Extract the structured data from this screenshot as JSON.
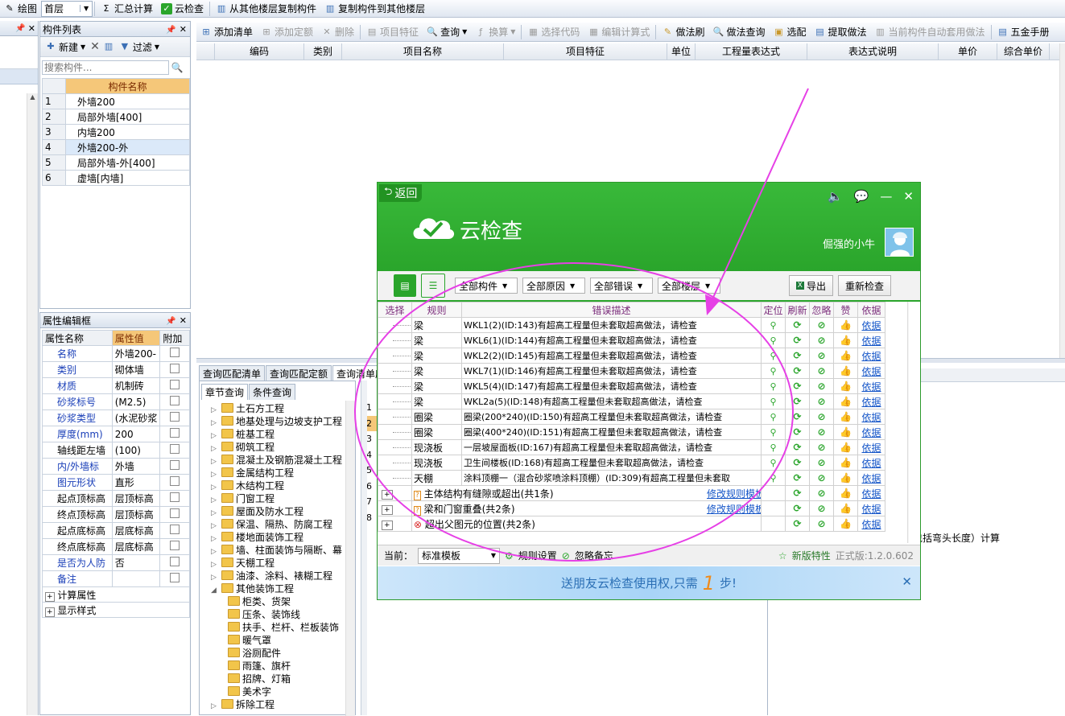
{
  "toolbar1": {
    "draw_label": "绘图",
    "floor_value": "首层",
    "sum_label": "汇总计算",
    "cloud_label": "云检查",
    "copy_from_label": "从其他楼层复制构件",
    "copy_to_label": "复制构件到其他楼层"
  },
  "component_list": {
    "title": "构件列表",
    "new_label": "新建",
    "filter_label": "过滤",
    "search_placeholder": "搜索构件...",
    "col_header": "构件名称",
    "rows": [
      {
        "no": "1",
        "name": "外墙200"
      },
      {
        "no": "2",
        "name": "局部外墙[400]"
      },
      {
        "no": "3",
        "name": "内墙200"
      },
      {
        "no": "4",
        "name": "外墙200-外"
      },
      {
        "no": "5",
        "name": "局部外墙-外[400]"
      },
      {
        "no": "6",
        "name": "虚墙[内墙]"
      }
    ]
  },
  "props": {
    "title": "属性编辑框",
    "col_name": "属性名称",
    "col_value": "属性值",
    "col_extra": "附加",
    "rows": [
      {
        "name": "名称",
        "value": "外墙200-",
        "blue": true
      },
      {
        "name": "类别",
        "value": "砌体墙",
        "blue": true
      },
      {
        "name": "材质",
        "value": "机制砖",
        "blue": true
      },
      {
        "name": "砂浆标号",
        "value": "(M2.5)",
        "blue": true
      },
      {
        "name": "砂浆类型",
        "value": "(水泥砂浆",
        "blue": true
      },
      {
        "name": "厚度(mm)",
        "value": "200",
        "blue": true
      },
      {
        "name": "轴线距左墙",
        "value": "(100)",
        "blue": false
      },
      {
        "name": "内/外墙标",
        "value": "外墙",
        "blue": true
      },
      {
        "name": "图元形状",
        "value": "直形",
        "blue": true
      },
      {
        "name": "起点顶标高",
        "value": "层顶标高",
        "blue": false
      },
      {
        "name": "终点顶标高",
        "value": "层顶标高",
        "blue": false
      },
      {
        "name": "起点底标高",
        "value": "层底标高",
        "blue": false
      },
      {
        "name": "终点底标高",
        "value": "层底标高",
        "blue": false
      },
      {
        "name": "是否为人防",
        "value": "否",
        "blue": true
      },
      {
        "name": "备注",
        "value": "",
        "blue": true
      }
    ],
    "group1": "计算属性",
    "group2": "显示样式"
  },
  "toolbar2": {
    "add_list": "添加清单",
    "add_quota": "添加定额",
    "delete": "删除",
    "feature": "项目特征",
    "query": "查询",
    "convert": "换算",
    "select_code": "选择代码",
    "edit_formula": "编辑计算式",
    "method_brush": "做法刷",
    "method_query": "做法查询",
    "pick": "选配",
    "extract": "提取做法",
    "auto_apply": "当前构件自动套用做法",
    "manual": "五金手册"
  },
  "main_headers": [
    "编码",
    "类别",
    "项目名称",
    "项目特征",
    "单位",
    "工程量表达式",
    "表达式说明",
    "单价",
    "综合单价"
  ],
  "query": {
    "tabs": [
      "查询匹配清单",
      "查询匹配定额",
      "查询清单库"
    ],
    "subtabs": [
      "章节查询",
      "条件查询"
    ],
    "tree": [
      {
        "label": "土石方工程",
        "level": 0,
        "open": false
      },
      {
        "label": "地基处理与边坡支护工程",
        "level": 0,
        "open": false
      },
      {
        "label": "桩基工程",
        "level": 0,
        "open": false
      },
      {
        "label": "砌筑工程",
        "level": 0,
        "open": false
      },
      {
        "label": "混凝土及钢筋混凝土工程",
        "level": 0,
        "open": false
      },
      {
        "label": "金属结构工程",
        "level": 0,
        "open": false
      },
      {
        "label": "木结构工程",
        "level": 0,
        "open": false
      },
      {
        "label": "门窗工程",
        "level": 0,
        "open": false
      },
      {
        "label": "屋面及防水工程",
        "level": 0,
        "open": false
      },
      {
        "label": "保温、隔热、防腐工程",
        "level": 0,
        "open": false
      },
      {
        "label": "楼地面装饰工程",
        "level": 0,
        "open": false
      },
      {
        "label": "墙、柱面装饰与隔断、幕",
        "level": 0,
        "open": false
      },
      {
        "label": "天棚工程",
        "level": 0,
        "open": false
      },
      {
        "label": "油漆、涂料、裱糊工程",
        "level": 0,
        "open": false
      },
      {
        "label": "其他装饰工程",
        "level": 0,
        "open": true
      },
      {
        "label": "柜类、货架",
        "level": 1
      },
      {
        "label": "压条、装饰线",
        "level": 1
      },
      {
        "label": "扶手、栏杆、栏板装饰",
        "level": 1
      },
      {
        "label": "暖气罩",
        "level": 1
      },
      {
        "label": "浴厕配件",
        "level": 1
      },
      {
        "label": "雨篷、旗杆",
        "level": 1
      },
      {
        "label": "招牌、灯箱",
        "level": 1
      },
      {
        "label": "美术字",
        "level": 1
      },
      {
        "label": "拆除工程",
        "level": 0,
        "open": false
      }
    ],
    "row_numbers": [
      "1",
      "2",
      "3",
      "4",
      "5",
      "6",
      "7",
      "8"
    ],
    "right_text": "包括弯头长度）计算"
  },
  "dialog": {
    "back_label": "返回",
    "title": "云检查",
    "username": "倔强的小牛",
    "filters": [
      "全部构件",
      "全部原因",
      "全部错误",
      "全部楼层"
    ],
    "export_label": "导出",
    "recheck_label": "重新检查",
    "headers": {
      "select": "选择",
      "rule": "规则",
      "desc": "错误描述",
      "locate": "定位",
      "refresh": "刷新",
      "ignore": "忽略",
      "like": "赞",
      "basis": "依据"
    },
    "rows": [
      {
        "rule": "梁",
        "desc": "WKL1(2)(ID:143)有超高工程量但未套取超高做法，请检查",
        "basis": "依据"
      },
      {
        "rule": "梁",
        "desc": "WKL6(1)(ID:144)有超高工程量但未套取超高做法，请检查",
        "basis": "依据"
      },
      {
        "rule": "梁",
        "desc": "WKL2(2)(ID:145)有超高工程量但未套取超高做法，请检查",
        "basis": "依据"
      },
      {
        "rule": "梁",
        "desc": "WKL7(1)(ID:146)有超高工程量但未套取超高做法，请检查",
        "basis": "依据"
      },
      {
        "rule": "梁",
        "desc": "WKL5(4)(ID:147)有超高工程量但未套取超高做法，请检查",
        "basis": "依据"
      },
      {
        "rule": "梁",
        "desc": "WKL2a(5)(ID:148)有超高工程量但未套取超高做法，请检查",
        "basis": "依据"
      },
      {
        "rule": "圈梁",
        "desc": "圈梁(200*240)(ID:150)有超高工程量但未套取超高做法，请检查",
        "basis": "依据"
      },
      {
        "rule": "圈梁",
        "desc": "圈梁(400*240)(ID:151)有超高工程量但未套取超高做法，请检查",
        "basis": "依据"
      },
      {
        "rule": "现浇板",
        "desc": "一层坡屋面板(ID:167)有超高工程量但未套取超高做法，请检查",
        "basis": "依据"
      },
      {
        "rule": "现浇板",
        "desc": "卫生间楼板(ID:168)有超高工程量但未套取超高做法，请检查",
        "basis": "依据"
      },
      {
        "rule": "天棚",
        "desc": "涂料顶棚一（混合砂浆喷涂料顶棚）(ID:309)有超高工程量但未套取",
        "basis": "依据"
      }
    ],
    "groups": [
      {
        "label": "主体结构有缝隙或超出(共1条)",
        "link": "修改规则模板",
        "basis": "依据",
        "kind": "warn"
      },
      {
        "label": "梁和门窗重叠(共2条)",
        "link": "修改规则模板",
        "basis": "依据",
        "kind": "warn"
      },
      {
        "label": "超出父图元的位置(共2条)",
        "link": "",
        "basis": "依据",
        "kind": "error"
      }
    ],
    "footer": {
      "current_label": "当前：",
      "template_value": "标准模板",
      "rule_setting": "规则设置",
      "ignore_memo": "忽略备忘",
      "new_features": "新版特性",
      "version": "正式版:1.2.0.602"
    },
    "promo_prefix": "送朋友云检查使用权,只需",
    "promo_number": "1",
    "promo_suffix": "步!"
  },
  "colors": {
    "green": "#2aa52b",
    "magenta": "#e640e6",
    "blue_text": "#1a3fb8"
  }
}
